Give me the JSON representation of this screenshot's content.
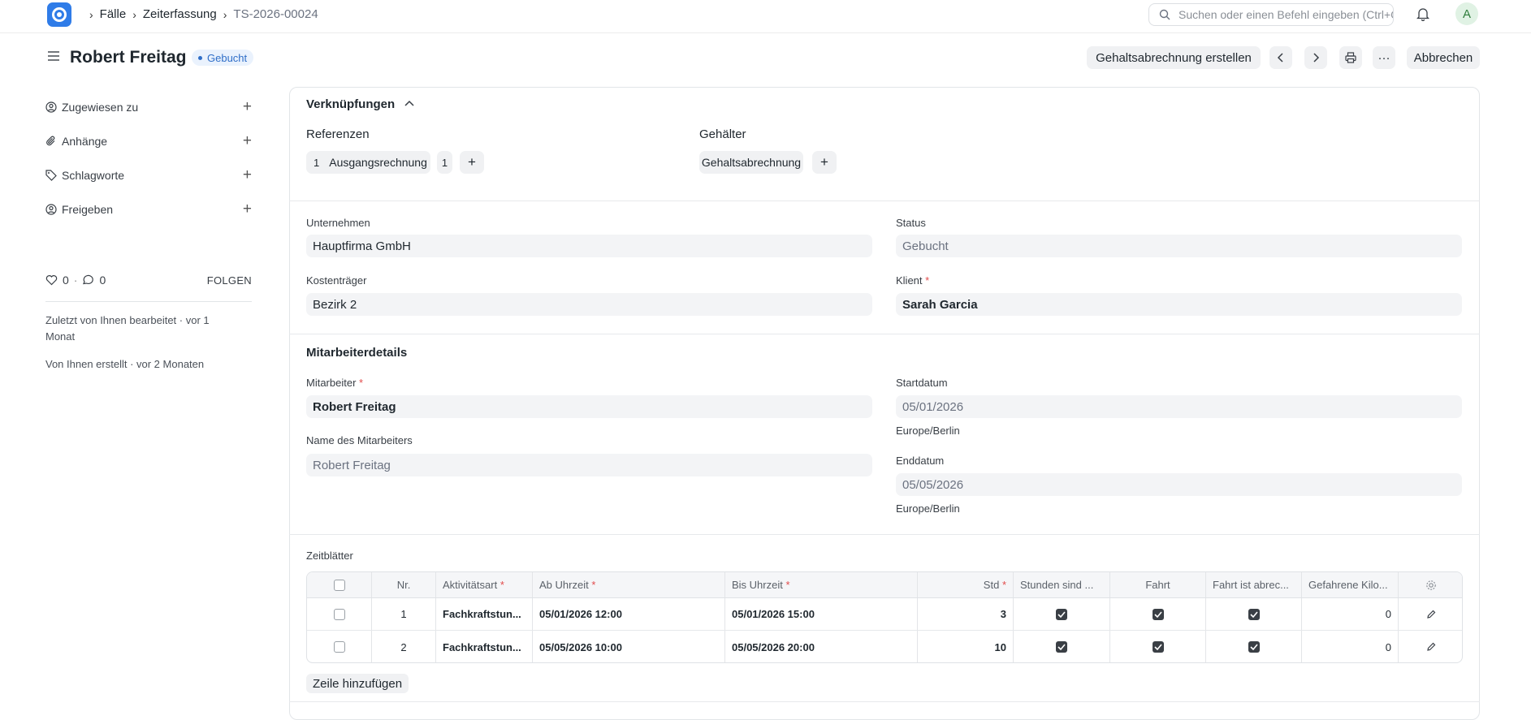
{
  "breadcrumbs": [
    "Fälle",
    "Zeiterfassung",
    "TS-2026-00024"
  ],
  "search": {
    "placeholder": "Suchen oder einen Befehl eingeben (Ctrl+G)"
  },
  "user": {
    "avatar_letter": "A"
  },
  "page": {
    "title": "Robert Freitag",
    "status": "Gebucht"
  },
  "actions": {
    "create_salary": "Gehaltsabrechnung erstellen",
    "more": "···",
    "cancel": "Abbrechen"
  },
  "sidebar": {
    "items": [
      {
        "label": "Zugewiesen zu",
        "icon": "user-assign-icon"
      },
      {
        "label": "Anhänge",
        "icon": "paperclip-icon"
      },
      {
        "label": "Schlagworte",
        "icon": "tag-icon"
      },
      {
        "label": "Freigeben",
        "icon": "share-icon"
      }
    ],
    "likes": "0",
    "comments": "0",
    "follow": "FOLGEN",
    "last_edited": "Zuletzt von Ihnen bearbeitet · vor 1 Monat",
    "created": "Von Ihnen erstellt · vor 2 Monaten"
  },
  "links": {
    "heading": "Verknüpfungen",
    "references_label": "Referenzen",
    "references": [
      {
        "count": "1",
        "label": "Ausgangsrechnung",
        "extra_count": "1"
      }
    ],
    "salaries_label": "Gehälter",
    "salaries": [
      {
        "label": "Gehaltsabrechnung"
      }
    ]
  },
  "form": {
    "company_label": "Unternehmen",
    "company": "Hauptfirma GmbH",
    "status_label": "Status",
    "status": "Gebucht",
    "cost_bearer_label": "Kostenträger",
    "cost_bearer": "Bezirk 2",
    "client_label": "Klient",
    "client": "Sarah Garcia",
    "employee_section": "Mitarbeiterdetails",
    "employee_label": "Mitarbeiter",
    "employee": "Robert Freitag",
    "employee_name_label": "Name des Mitarbeiters",
    "employee_name": "Robert Freitag",
    "start_label": "Startdatum",
    "start": "05/01/2026",
    "start_tz": "Europe/Berlin",
    "end_label": "Enddatum",
    "end": "05/05/2026",
    "end_tz": "Europe/Berlin"
  },
  "timesheets": {
    "label": "Zeitblätter",
    "columns": [
      "Nr.",
      "Aktivitätsart",
      "Ab Uhrzeit",
      "Bis Uhrzeit",
      "Std",
      "Stunden sind ...",
      "Fahrt",
      "Fahrt ist abrec...",
      "Gefahrene Kilo..."
    ],
    "rows": [
      {
        "nr": "1",
        "activity": "Fachkraftstun...",
        "from": "05/01/2026 12:00",
        "to": "05/01/2026 15:00",
        "hours": "3",
        "billable": true,
        "travel": true,
        "travel_billable": true,
        "km": "0"
      },
      {
        "nr": "2",
        "activity": "Fachkraftstun...",
        "from": "05/05/2026 10:00",
        "to": "05/05/2026 20:00",
        "hours": "10",
        "billable": true,
        "travel": true,
        "travel_billable": true,
        "km": "0"
      }
    ],
    "add_row": "Zeile hinzufügen"
  }
}
